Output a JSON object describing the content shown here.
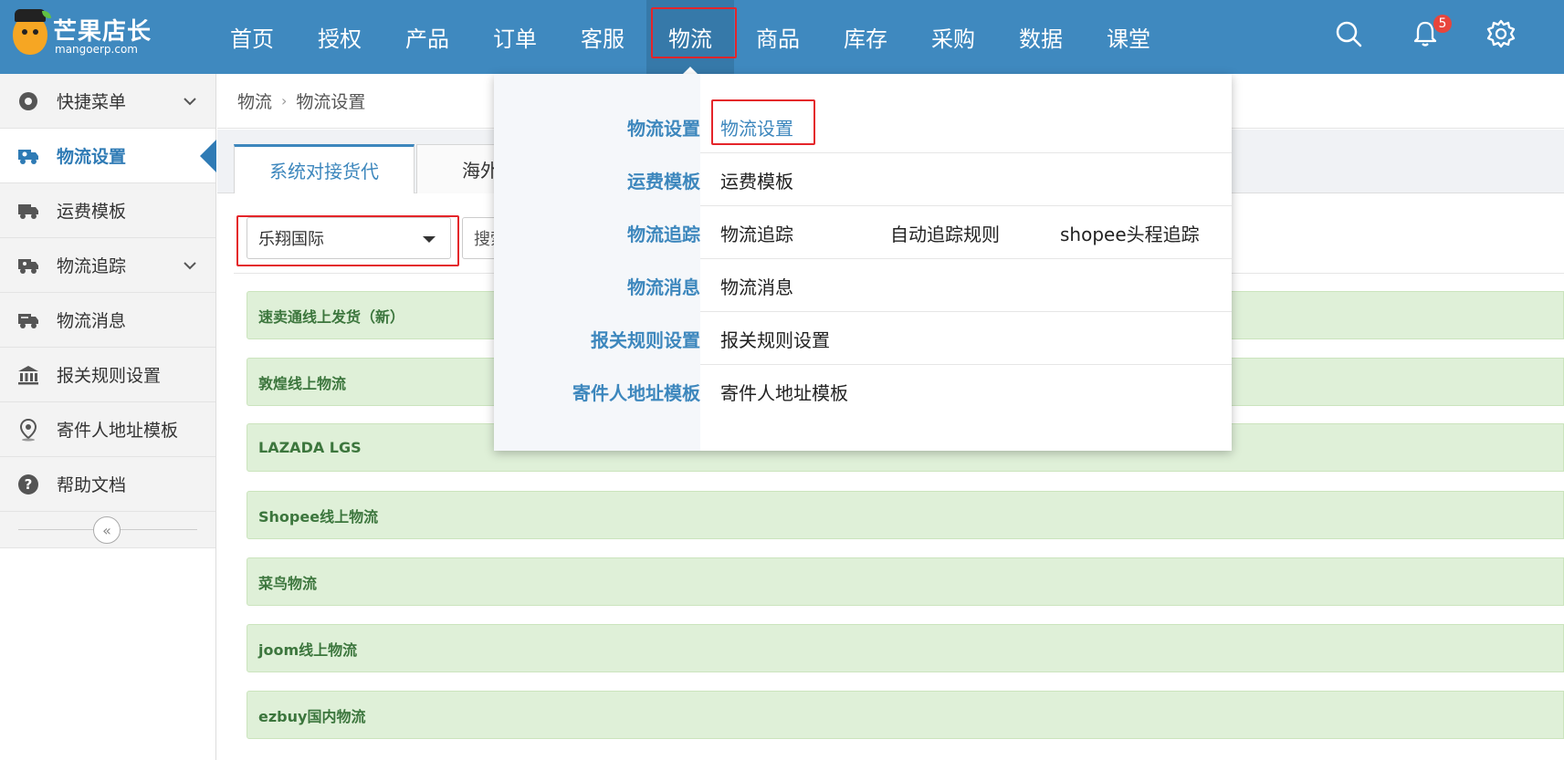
{
  "brand": {
    "title": "芒果店长",
    "subtitle": "mangoerp.com"
  },
  "nav": {
    "items": [
      "首页",
      "授权",
      "产品",
      "订单",
      "客服",
      "物流",
      "商品",
      "库存",
      "采购",
      "数据",
      "课堂"
    ],
    "active": "物流"
  },
  "header": {
    "notification_count": "5"
  },
  "sidebar": {
    "items": [
      {
        "label": "快捷菜单",
        "icon": "settings-circle-icon"
      },
      {
        "label": "物流设置",
        "icon": "truck-gear-icon"
      },
      {
        "label": "运费模板",
        "icon": "truck-icon"
      },
      {
        "label": "物流追踪",
        "icon": "truck-location-icon"
      },
      {
        "label": "物流消息",
        "icon": "truck-message-icon"
      },
      {
        "label": "报关规则设置",
        "icon": "bank-icon"
      },
      {
        "label": "寄件人地址模板",
        "icon": "map-pin-icon"
      },
      {
        "label": "帮助文档",
        "icon": "question-icon"
      }
    ],
    "active": "物流设置"
  },
  "breadcrumb": {
    "root": "物流",
    "current": "物流设置"
  },
  "tabs": [
    "系统对接货代",
    "海外仓"
  ],
  "filter": {
    "selected_provider": "乐翔国际",
    "search_partial": "搜索"
  },
  "carriers": [
    "速卖通线上发货（新）",
    "敦煌线上物流",
    "LAZADA LGS",
    "Shopee线上物流",
    "菜鸟物流",
    "joom线上物流",
    "ezbuy国内物流"
  ],
  "dropdown": {
    "rows": [
      {
        "category": "物流设置",
        "links": [
          "物流设置"
        ]
      },
      {
        "category": "运费模板",
        "links": [
          "运费模板"
        ]
      },
      {
        "category": "物流追踪",
        "links": [
          "物流追踪",
          "自动追踪规则",
          "shopee头程追踪"
        ]
      },
      {
        "category": "物流消息",
        "links": [
          "物流消息"
        ]
      },
      {
        "category": "报关规则设置",
        "links": [
          "报关规则设置"
        ]
      },
      {
        "category": "寄件人地址模板",
        "links": [
          "寄件人地址模板"
        ]
      }
    ]
  },
  "colors": {
    "topbar": "#3f89bf",
    "accent": "#3d87bd",
    "highlight": "#e4252a",
    "carrier_bg": "#dff0d8"
  }
}
